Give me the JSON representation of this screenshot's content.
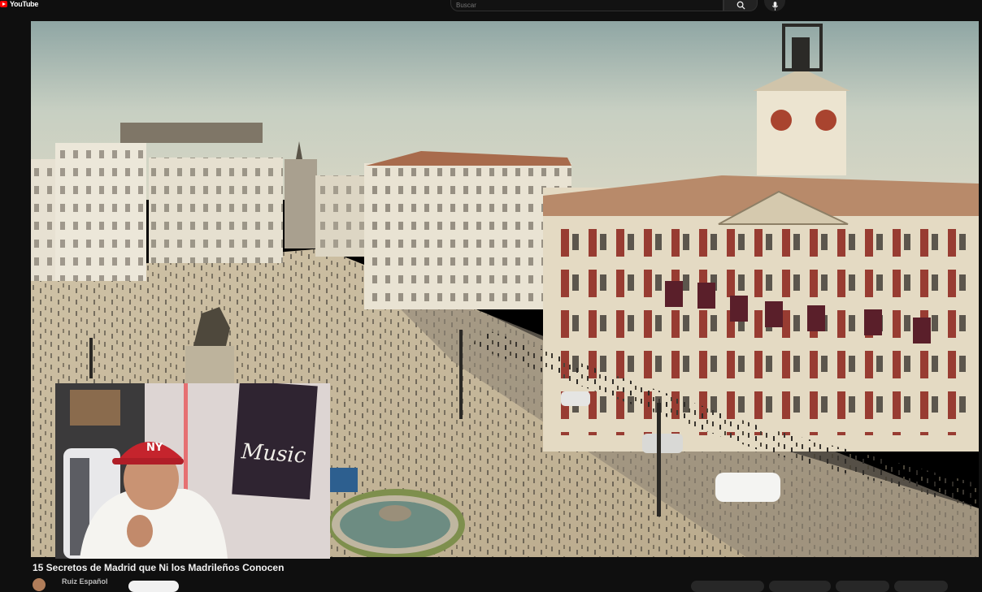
{
  "app": {
    "logo_text": "YouTube",
    "logo_icon": "youtube-logo-icon",
    "brand_color": "#ff0000"
  },
  "search": {
    "placeholder": "Buscar",
    "search_icon": "search-icon",
    "mic_icon": "microphone-icon"
  },
  "video": {
    "title": "15 Secretos de Madrid que Ni los Madrileños Conocen",
    "channel_name": "Ruiz Español",
    "webcam_sign_text": "Music"
  }
}
